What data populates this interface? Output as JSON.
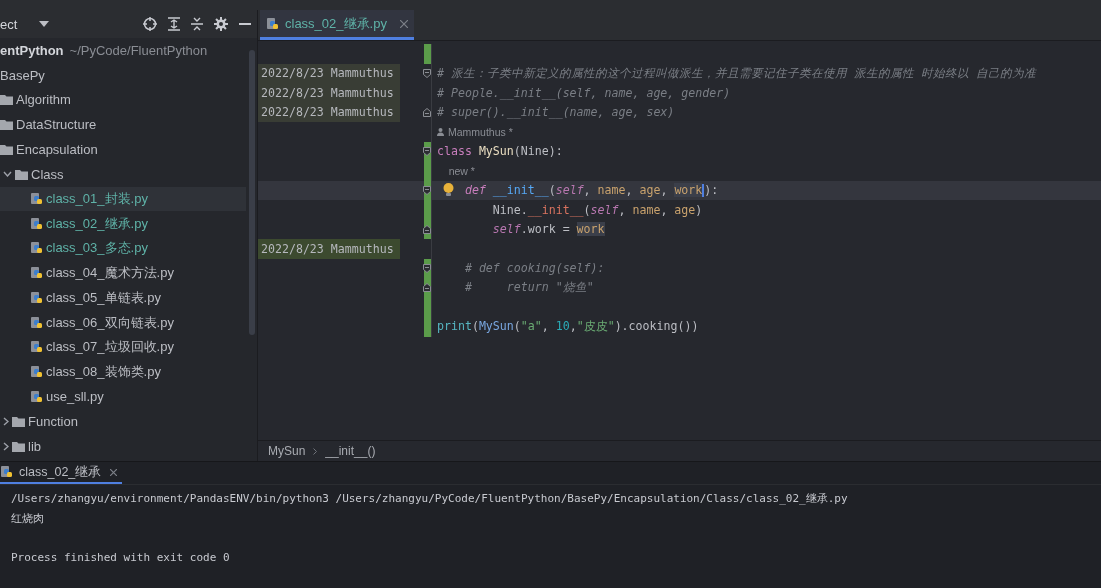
{
  "sidebar": {
    "title": "ect",
    "root": {
      "name": "entPython",
      "path": "~/PyCode/FluentPython"
    },
    "tree": [
      {
        "name": "BasePy",
        "selected": false,
        "children": [
          {
            "name": "Algorithm",
            "kind": "folder",
            "selected": false
          },
          {
            "name": "DataStructure",
            "kind": "folder",
            "selected": false
          },
          {
            "name": "Encapsulation",
            "kind": "folder",
            "selected": false,
            "children": [
              {
                "name": "Class",
                "kind": "folder",
                "selected": false,
                "expanded": true,
                "children": [
                  {
                    "name": "class_01_封装.py",
                    "kind": "file",
                    "selected": true,
                    "color": "#5fb3a8"
                  },
                  {
                    "name": "class_02_继承.py",
                    "kind": "file",
                    "selected": false,
                    "color": "#5fb3a8"
                  },
                  {
                    "name": "class_03_多态.py",
                    "kind": "file",
                    "selected": false,
                    "color": "#5fb3a8"
                  },
                  {
                    "name": "class_04_魔术方法.py",
                    "kind": "file",
                    "selected": false,
                    "color": "#bcbec4"
                  },
                  {
                    "name": "class_05_单链表.py",
                    "kind": "file",
                    "selected": false,
                    "color": "#bcbec4"
                  },
                  {
                    "name": "class_06_双向链表.py",
                    "kind": "file",
                    "selected": false,
                    "color": "#bcbec4"
                  },
                  {
                    "name": "class_07_垃圾回收.py",
                    "kind": "file",
                    "selected": false,
                    "color": "#bcbec4"
                  },
                  {
                    "name": "class_08_装饰类.py",
                    "kind": "file",
                    "selected": false,
                    "color": "#bcbec4"
                  },
                  {
                    "name": "use_sll.py",
                    "kind": "file",
                    "selected": false,
                    "color": "#bcbec4"
                  }
                ]
              },
              {
                "name": "Function",
                "kind": "folder",
                "selected": false,
                "expanded": false
              },
              {
                "name": "lib",
                "kind": "folder",
                "selected": false,
                "expanded": false
              }
            ]
          }
        ]
      }
    ]
  },
  "editor": {
    "tabs": [
      {
        "label": "class_02_继承.py",
        "selected": true
      }
    ],
    "lines": [
      {
        "changed": true,
        "current": false,
        "bulb": false,
        "fold_start": false,
        "fold_end": false
      },
      {
        "changed": false,
        "current": false,
        "bulb": false,
        "fold_start": true,
        "fold_end": false,
        "blame": {
          "text": "2022/8/23 Mammuthus",
          "color": "#393d35"
        },
        "segments": [
          {
            "text": "# 派生：子类中新定义的属性的这个过程叫做派生，并且需要记住子类在使用 派生的属性 时始终以 自己的为准",
            "kind": "comment"
          }
        ]
      },
      {
        "changed": false,
        "current": false,
        "bulb": false,
        "fold_start": false,
        "fold_end": false,
        "blame": {
          "text": "2022/8/23 Mammuthus",
          "color": "#393d35"
        },
        "segments": [
          {
            "text": "# People.__init__(self, name, age, gender)",
            "kind": "comment"
          }
        ]
      },
      {
        "changed": false,
        "current": false,
        "bulb": false,
        "fold_start": false,
        "fold_end": true,
        "blame": {
          "text": "2022/8/23 Mammuthus",
          "color": "#393d35"
        },
        "segments": [
          {
            "text": "# super().__init__(name, age, sex)",
            "kind": "comment"
          }
        ]
      },
      {
        "changed": false,
        "current": false,
        "bulb": false,
        "fold_start": false,
        "fold_end": false,
        "segments": [
          {
            "text": "Mammuthus *",
            "kind": "author"
          }
        ]
      },
      {
        "changed": true,
        "current": false,
        "bulb": false,
        "fold_start": true,
        "fold_end": false,
        "segments": [
          {
            "text": "class",
            "kind": "keyword"
          },
          {
            "text": " MySun",
            "kind": "classname"
          },
          {
            "text": "(Nine):",
            "kind": "plain"
          }
        ]
      },
      {
        "changed": true,
        "current": false,
        "bulb": false,
        "fold_start": false,
        "fold_end": false,
        "segments": [
          {
            "text": "    new *",
            "kind": "inlay"
          }
        ]
      },
      {
        "changed": true,
        "current": true,
        "bulb": true,
        "fold_start": true,
        "fold_end": false,
        "segments": [
          {
            "text": "    def",
            "kind": "keyword"
          },
          {
            "text": " __init__",
            "kind": "funcdef"
          },
          {
            "text": "(",
            "kind": "plain"
          },
          {
            "text": "self",
            "kind": "self"
          },
          {
            "text": ", ",
            "kind": "plain"
          },
          {
            "text": "name",
            "kind": "param"
          },
          {
            "text": ", ",
            "kind": "plain"
          },
          {
            "text": "age",
            "kind": "param"
          },
          {
            "text": ", ",
            "kind": "plain"
          },
          {
            "text": "work",
            "kind": "param",
            "highlight": true,
            "cursor": true
          },
          {
            "text": "):",
            "kind": "plain"
          }
        ]
      },
      {
        "changed": true,
        "current": false,
        "bulb": false,
        "fold_start": false,
        "fold_end": false,
        "segments": [
          {
            "text": "        Nine.",
            "kind": "plain"
          },
          {
            "text": "__init__",
            "kind": "dunder"
          },
          {
            "text": "(",
            "kind": "plain"
          },
          {
            "text": "self",
            "kind": "self"
          },
          {
            "text": ", ",
            "kind": "plain"
          },
          {
            "text": "name",
            "kind": "param"
          },
          {
            "text": ", ",
            "kind": "plain"
          },
          {
            "text": "age",
            "kind": "param"
          },
          {
            "text": ")",
            "kind": "plain"
          }
        ]
      },
      {
        "changed": true,
        "current": false,
        "bulb": false,
        "fold_start": false,
        "fold_end": true,
        "segments": [
          {
            "text": "        self",
            "kind": "self"
          },
          {
            "text": ".work = ",
            "kind": "plain"
          },
          {
            "text": "work",
            "kind": "param",
            "highlight": true
          }
        ]
      },
      {
        "changed": false,
        "current": false,
        "bulb": false,
        "fold_start": false,
        "fold_end": false,
        "blame": {
          "text": "2022/8/23 Mammuthus",
          "color": "#3c4a2f"
        }
      },
      {
        "changed": true,
        "current": false,
        "bulb": false,
        "fold_start": true,
        "fold_end": false,
        "segments": [
          {
            "text": "    # def cooking(self):",
            "kind": "comment"
          }
        ]
      },
      {
        "changed": true,
        "current": false,
        "bulb": false,
        "fold_start": false,
        "fold_end": true,
        "segments": [
          {
            "text": "    #     return \"烧鱼\"",
            "kind": "comment"
          }
        ]
      },
      {
        "changed": true,
        "current": false,
        "bulb": false,
        "fold_start": false,
        "fold_end": false
      },
      {
        "changed": true,
        "current": false,
        "bulb": false,
        "fold_start": false,
        "fold_end": false,
        "segments": [
          {
            "text": "print",
            "kind": "builtin"
          },
          {
            "text": "(",
            "kind": "plain"
          },
          {
            "text": "MySun",
            "kind": "call"
          },
          {
            "text": "(",
            "kind": "plain"
          },
          {
            "text": "\"a\"",
            "kind": "string"
          },
          {
            "text": ", ",
            "kind": "plain"
          },
          {
            "text": "10",
            "kind": "number"
          },
          {
            "text": ",",
            "kind": "plain"
          },
          {
            "text": "\"皮皮\"",
            "kind": "string"
          },
          {
            "text": ").cooking())",
            "kind": "plain"
          }
        ]
      }
    ],
    "breadcrumb": [
      "MySun",
      "__init__()"
    ]
  },
  "run_panel": {
    "tabs": [
      {
        "label": "class_02_继承",
        "selected": true
      }
    ],
    "output": [
      "/Users/zhangyu/environment/PandasENV/bin/python3 /Users/zhangyu/PyCode/FluentPython/BasePy/Encapsulation/Class/class_02_继承.py",
      "红烧肉",
      "Process finished with exit code 0"
    ]
  }
}
